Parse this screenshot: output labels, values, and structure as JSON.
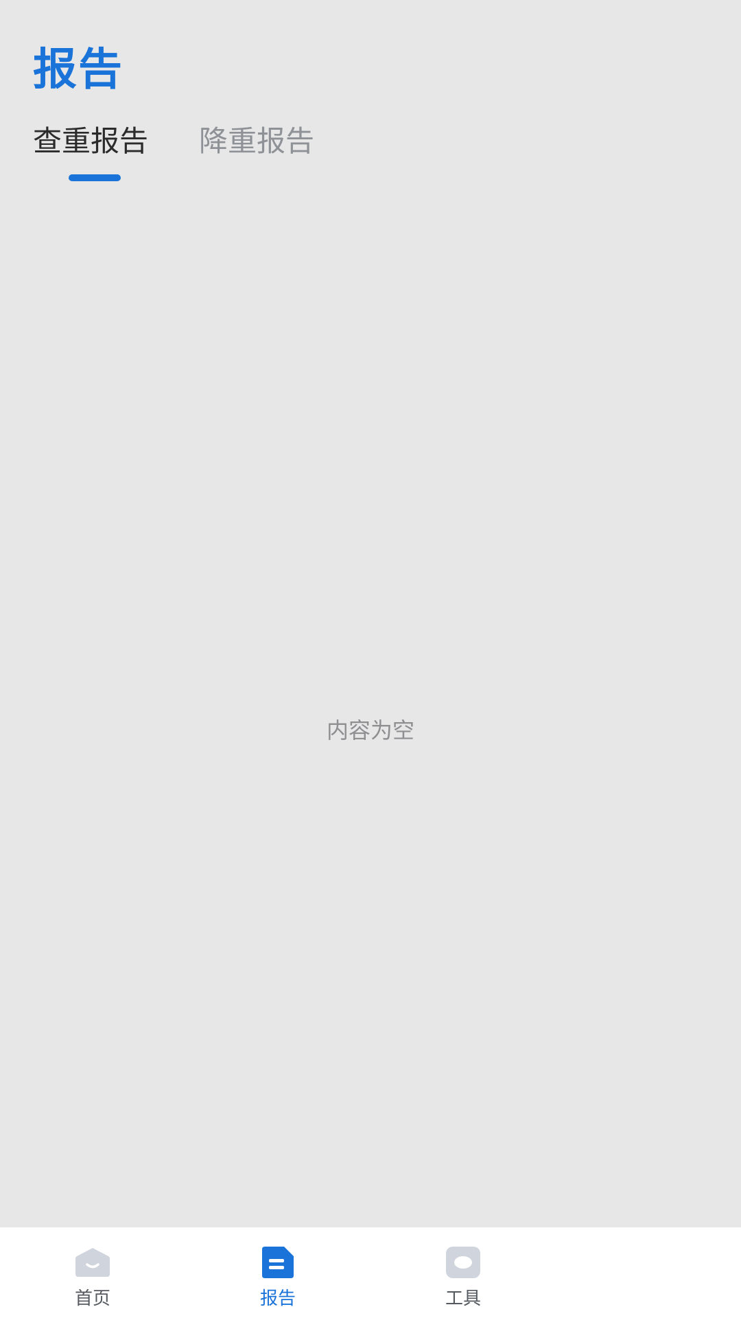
{
  "header": {
    "title": "报告"
  },
  "tabs": [
    {
      "label": "查重报告",
      "active": true
    },
    {
      "label": "降重报告",
      "active": false
    }
  ],
  "content": {
    "empty_text": "内容为空"
  },
  "bottom_nav": {
    "items": [
      {
        "label": "首页",
        "icon": "home-icon",
        "active": false
      },
      {
        "label": "报告",
        "icon": "report-icon",
        "active": true
      },
      {
        "label": "工具",
        "icon": "tools-icon",
        "active": false
      }
    ]
  },
  "colors": {
    "accent": "#1a73d9",
    "background": "#e7e7e8",
    "inactive_icon": "#d0d4dc",
    "inactive_text": "#8e9196"
  }
}
